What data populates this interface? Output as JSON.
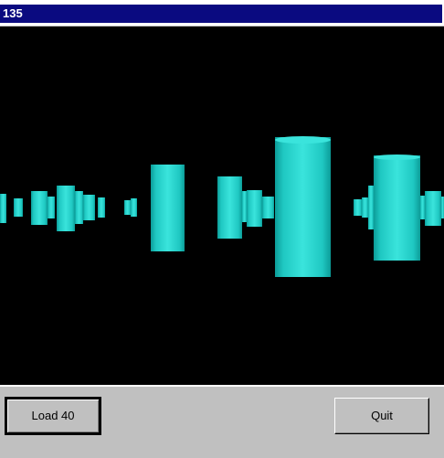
{
  "window": {
    "title": "135"
  },
  "buttons": {
    "load_label": "Load 40",
    "quit_label": "Quit"
  },
  "colors": {
    "title_bar": "#0a0a80",
    "viewport_bg": "#000000",
    "cylinder": "#22d6d0",
    "panel": "#c0c0c0"
  },
  "scene": {
    "object_shape": "cylinder",
    "object_count_visible": 19
  }
}
